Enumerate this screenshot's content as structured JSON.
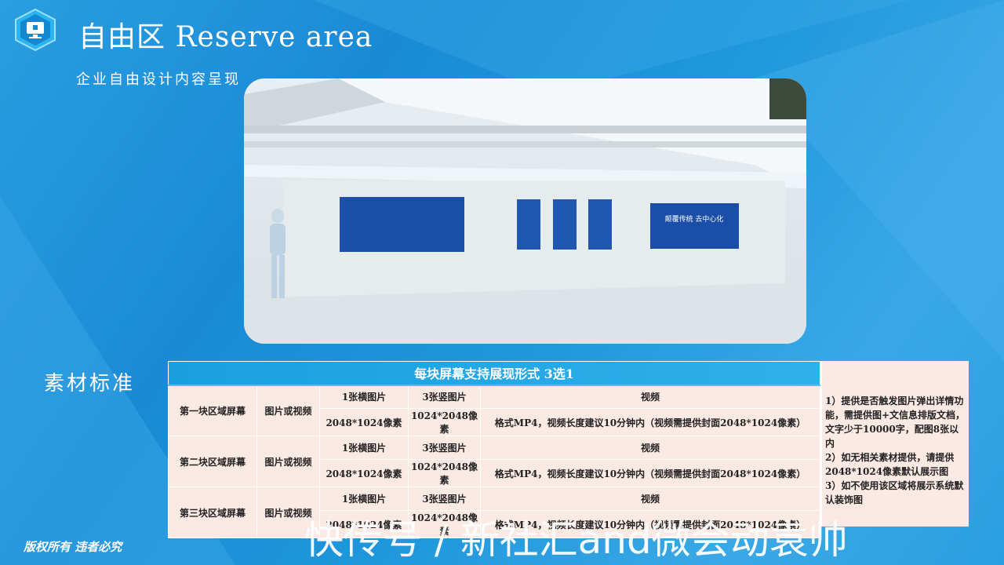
{
  "header": {
    "title": "自由区 Reserve area",
    "subtitle": "企业自由设计内容呈现",
    "logo_icon": "monitor-hexagon-icon"
  },
  "scene": {
    "screen_text": "颠覆传统 去中心化"
  },
  "section_label": "素材标准",
  "table": {
    "header": "每块屏幕支持展现形式 3选1",
    "rows": [
      {
        "region": "第一块区域屏幕",
        "type": "图片或视频",
        "opt1": "1张横图片",
        "opt2": "3张竖图片",
        "opt3": "视频",
        "spec1": "2048*1024像素",
        "spec2": "1024*2048像素",
        "spec3": "格式MP4，视频长度建议10分钟内（视频需提供封面2048*1024像素）"
      },
      {
        "region": "第二块区域屏幕",
        "type": "图片或视频",
        "opt1": "1张横图片",
        "opt2": "3张竖图片",
        "opt3": "视频",
        "spec1": "2048*1024像素",
        "spec2": "1024*2048像素",
        "spec3": "格式MP4，视频长度建议10分钟内（视频需提供封面2048*1024像素）"
      },
      {
        "region": "第三块区域屏幕",
        "type": "图片或视频",
        "opt1": "1张横图片",
        "opt2": "3张竖图片",
        "opt3": "视频",
        "spec1": "2048*1024像素",
        "spec2": "1024*2048像素",
        "spec3": "格式MP4，视频长度建议10分钟内（视频需提供封面2048*1024像素）"
      }
    ]
  },
  "notes": [
    "1）提供是否触发图片弹出详情功能，需提供图+文信息排版文档，文字少于10000字，配图8张以内",
    "2）如无相关素材提供，请提供2048*1024像素默认展示图",
    "3）如不使用该区域将展示系统默认装饰图"
  ],
  "footer": {
    "copyright": "版权所有 违者必究"
  },
  "watermark": "快传号 / 新社汇and微会动袁帅"
}
